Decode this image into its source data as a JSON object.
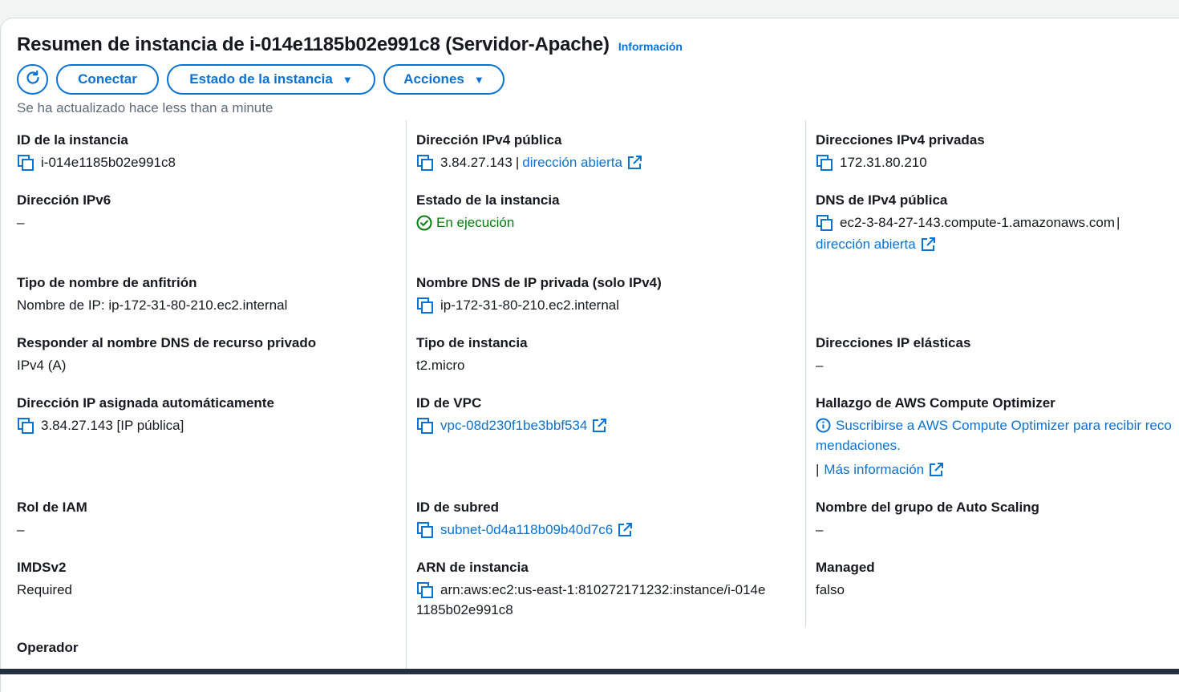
{
  "header": {
    "title": "Resumen de instancia de i-014e1185b02e991c8 (Servidor-Apache)",
    "info_link": "Información"
  },
  "toolbar": {
    "refresh_icon": "refresh-icon",
    "connect_label": "Conectar",
    "instance_state_label": "Estado de la instancia",
    "actions_label": "Acciones",
    "updated_text": "Se ha actualizado hace less than a minute"
  },
  "details": {
    "instance_id": {
      "label": "ID de la instancia",
      "value": "i-014e1185b02e991c8"
    },
    "ipv6": {
      "label": "Dirección IPv6",
      "value": "–"
    },
    "hostname_type": {
      "label": "Tipo de nombre de anfitrión",
      "value": "Nombre de IP: ip-172-31-80-210.ec2.internal"
    },
    "resource_dns": {
      "label": "Responder al nombre DNS de recurso privado",
      "value": "IPv4 (A)"
    },
    "auto_ip": {
      "label": "Dirección IP asignada automáticamente",
      "value": "3.84.27.143 [IP pública]"
    },
    "iam_role": {
      "label": "Rol de IAM",
      "value": "–"
    },
    "imdsv2": {
      "label": "IMDSv2",
      "value": "Required"
    },
    "operator": {
      "label": "Operador",
      "value": "–"
    },
    "public_ipv4": {
      "label": "Dirección IPv4 pública",
      "value": "3.84.27.143",
      "separator": "|",
      "link": "dirección abierta"
    },
    "instance_state": {
      "label": "Estado de la instancia",
      "value": "En ejecución"
    },
    "private_dns": {
      "label": "Nombre DNS de IP privada (solo IPv4)",
      "value": "ip-172-31-80-210.ec2.internal"
    },
    "instance_type": {
      "label": "Tipo de instancia",
      "value": "t2.micro"
    },
    "vpc_id": {
      "label": "ID de VPC",
      "value": "vpc-08d230f1be3bbf534"
    },
    "subnet_id": {
      "label": "ID de subred",
      "value": "subnet-0d4a118b09b40d7c6"
    },
    "instance_arn": {
      "label": "ARN de instancia",
      "value_line1": "arn:aws:ec2:us-east-1:810272171232:instance/i-014e",
      "value_line2": "1185b02e991c8"
    },
    "private_ipv4": {
      "label": "Direcciones IPv4 privadas",
      "value": "172.31.80.210"
    },
    "public_dns": {
      "label": "DNS de IPv4 pública",
      "value": "ec2-3-84-27-143.compute-1.amazonaws.com",
      "separator": "|",
      "link": "dirección abierta"
    },
    "elastic_ip": {
      "label": "Direcciones IP elásticas",
      "value": "–"
    },
    "compute_optimizer": {
      "label": "Hallazgo de AWS Compute Optimizer",
      "link_line1": "Suscribirse a AWS Compute Optimizer para recibir reco",
      "link_line2": "mendaciones.",
      "separator": "|",
      "more_link": "Más información"
    },
    "asg_name": {
      "label": "Nombre del grupo de Auto Scaling",
      "value": "–"
    },
    "managed": {
      "label": "Managed",
      "value": "falso"
    }
  },
  "colors": {
    "accent": "#0972d3",
    "success": "#037f0c",
    "muted": "#5f6b7a",
    "text": "#16191f"
  }
}
